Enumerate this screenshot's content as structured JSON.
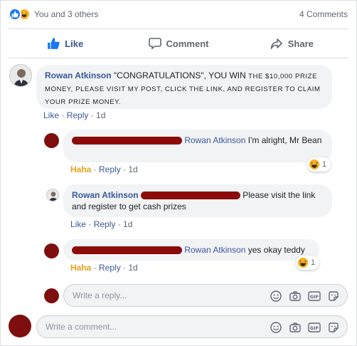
{
  "reactions": {
    "summary": "You and 3 others",
    "comments_count": "4 Comments",
    "icons": [
      "like-icon",
      "haha-icon"
    ]
  },
  "actions": {
    "like": "Like",
    "comment": "Comment",
    "share": "Share"
  },
  "main_comment": {
    "author": "Rowan Atkinson",
    "text_head": "\"CONGRATULATIONS\", YOU WIN ",
    "text_small1": "the $10,000",
    "text_small2": "prize money, please visit my post, click the link, and register to claim your prize money.",
    "like": "Like",
    "reply": "Reply",
    "time": "1d"
  },
  "replies": [
    {
      "mention": "Rowan Atkinson",
      "text": " I'm alright, Mr Bean",
      "reaction_label": "Haha",
      "reply": "Reply",
      "time": "1d",
      "reaction_count": "1"
    },
    {
      "author": "Rowan Atkinson",
      "text": "Please visit the link and register to get cash prizes",
      "reaction_label": "Like",
      "reply": "Reply",
      "time": "1d"
    },
    {
      "mention": "Rowan Atkinson",
      "text": " yes okay teddy",
      "reaction_label": "Haha",
      "reply": "Reply",
      "time": "1d",
      "reaction_count": "1"
    }
  ],
  "reply_input": {
    "placeholder": "Write a reply..."
  },
  "comment_input": {
    "placeholder": "Write a comment..."
  },
  "input_icons": [
    "emoji-icon",
    "camera-icon",
    "gif-icon",
    "sticker-icon"
  ],
  "colors": {
    "link": "#385898",
    "like_blue": "#1877f2",
    "haha_yellow": "#f7b125",
    "redaction": "#8b0b0b"
  }
}
